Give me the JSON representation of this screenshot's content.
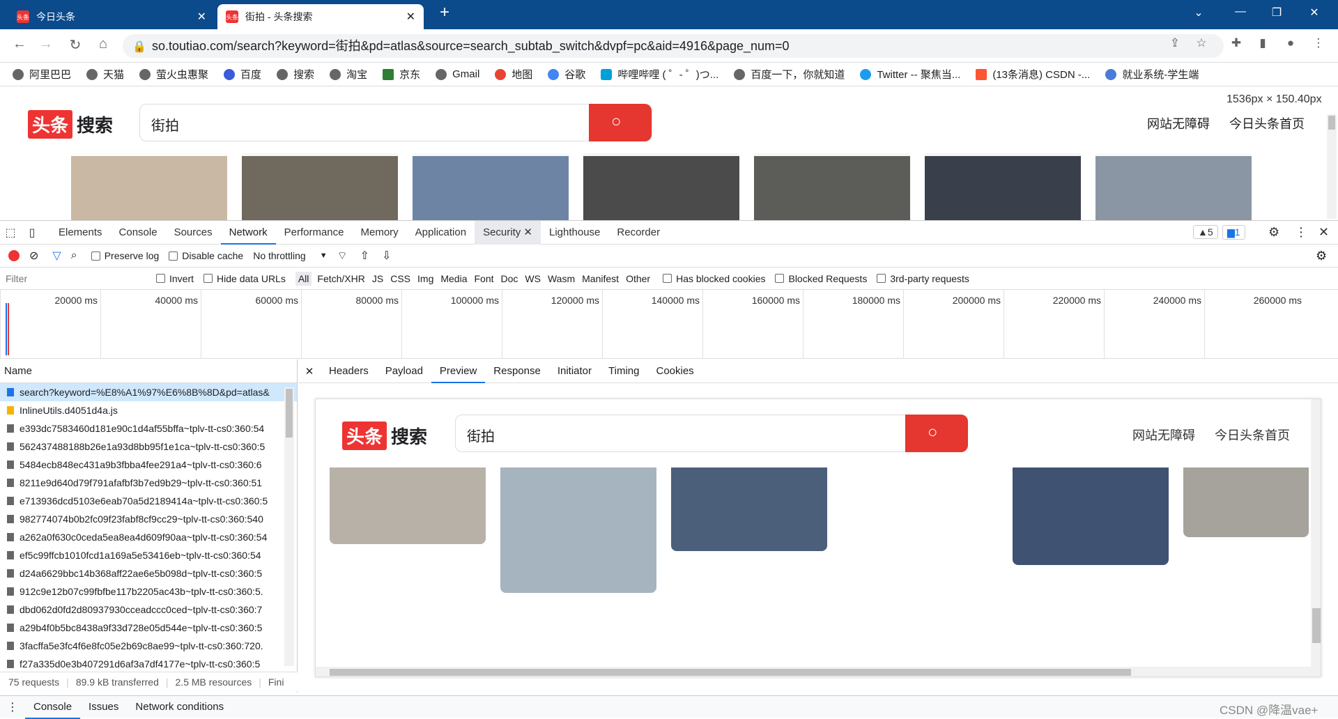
{
  "tabs": [
    {
      "title": "今日头条"
    },
    {
      "title": "街拍 - 头条搜索"
    }
  ],
  "tab_icon_text": "头条",
  "new_tab": "+",
  "window_controls": {
    "dropdown": "⌄",
    "minimize": "—",
    "maximize": "❐",
    "close": "✕"
  },
  "address": {
    "url": "so.toutiao.com/search?keyword=街拍&pd=atlas&source=search_subtab_switch&dvpf=pc&aid=4916&page_num=0"
  },
  "bookmarks": [
    "阿里巴巴",
    "天猫",
    "萤火虫惠聚",
    "百度",
    "搜索",
    "淘宝",
    "京东",
    "Gmail",
    "地图",
    "谷歌",
    "哔哩哔哩 ( ゜- ゜)つ...",
    "百度一下，你就知道",
    "Twitter -- 聚焦当...",
    "(13条消息) CSDN -...",
    "就业系统-学生端"
  ],
  "page": {
    "logo_red": "头条",
    "logo_text": "搜索",
    "search_value": "街拍",
    "nav": [
      "网站无障碍",
      "今日头条首页"
    ],
    "dimension": "1536px × 150.40px"
  },
  "devtools": {
    "tabs": [
      "Elements",
      "Console",
      "Sources",
      "Network",
      "Performance",
      "Memory",
      "Application",
      "Security",
      "Lighthouse",
      "Recorder"
    ],
    "warnings": "5",
    "messages": "1",
    "toolbar": {
      "preserve_log": "Preserve log",
      "disable_cache": "Disable cache",
      "throttling": "No throttling"
    },
    "filter": {
      "placeholder": "Filter",
      "invert": "Invert",
      "hide_data_urls": "Hide data URLs",
      "types": [
        "All",
        "Fetch/XHR",
        "JS",
        "CSS",
        "Img",
        "Media",
        "Font",
        "Doc",
        "WS",
        "Wasm",
        "Manifest",
        "Other"
      ],
      "blocked_cookies": "Has blocked cookies",
      "blocked_requests": "Blocked Requests",
      "third_party": "3rd-party requests"
    },
    "timeline": [
      "20000 ms",
      "40000 ms",
      "60000 ms",
      "80000 ms",
      "100000 ms",
      "120000 ms",
      "140000 ms",
      "160000 ms",
      "180000 ms",
      "200000 ms",
      "220000 ms",
      "240000 ms",
      "260000 ms"
    ],
    "name_header": "Name",
    "requests": [
      "search?keyword=%E8%A1%97%E6%8B%8D&pd=atlas&",
      "InlineUtils.d4051d4a.js",
      "e393dc7583460d181e90c1d4af55bffa~tplv-tt-cs0:360:54",
      "562437488188b26e1a93d8bb95f1e1ca~tplv-tt-cs0:360:5",
      "5484ecb848ec431a9b3fbba4fee291a4~tplv-tt-cs0:360:6",
      "8211e9d640d79f791afafbf3b7ed9b29~tplv-tt-cs0:360:51",
      "e713936dcd5103e6eab70a5d2189414a~tplv-tt-cs0:360:5",
      "982774074b0b2fc09f23fabf8cf9cc29~tplv-tt-cs0:360:540",
      "a262a0f630c0ceda5ea8ea4d609f90aa~tplv-tt-cs0:360:54",
      "ef5c99ffcb1010fcd1a169a5e53416eb~tplv-tt-cs0:360:54",
      "d24a6629bbc14b368aff22ae6e5b098d~tplv-tt-cs0:360:5",
      "912c9e12b07c99fbfbe117b2205ac43b~tplv-tt-cs0:360:5.",
      "dbd062d0fd2d80937930cceadccc0ced~tplv-tt-cs0:360:7",
      "a29b4f0b5bc8438a9f33d728e05d544e~tplv-tt-cs0:360:5",
      "3facffa5e3fc4f6e8fc05e2b69c8ae99~tplv-tt-cs0:360:720.",
      "f27a335d0e3b407291d6af3a7df4177e~tplv-tt-cs0:360:5"
    ],
    "detail_tabs": [
      "Headers",
      "Payload",
      "Preview",
      "Response",
      "Initiator",
      "Timing",
      "Cookies"
    ],
    "status": [
      "75 requests",
      "89.9 kB transferred",
      "2.5 MB resources",
      "Fini"
    ],
    "drawer": [
      "Console",
      "Issues",
      "Network conditions"
    ],
    "watermark": "CSDN @降温vae+"
  },
  "colors": {
    "accent": "#1a73e8",
    "brand_red": "#e5362f",
    "tabbar": "#0b4a8b"
  }
}
